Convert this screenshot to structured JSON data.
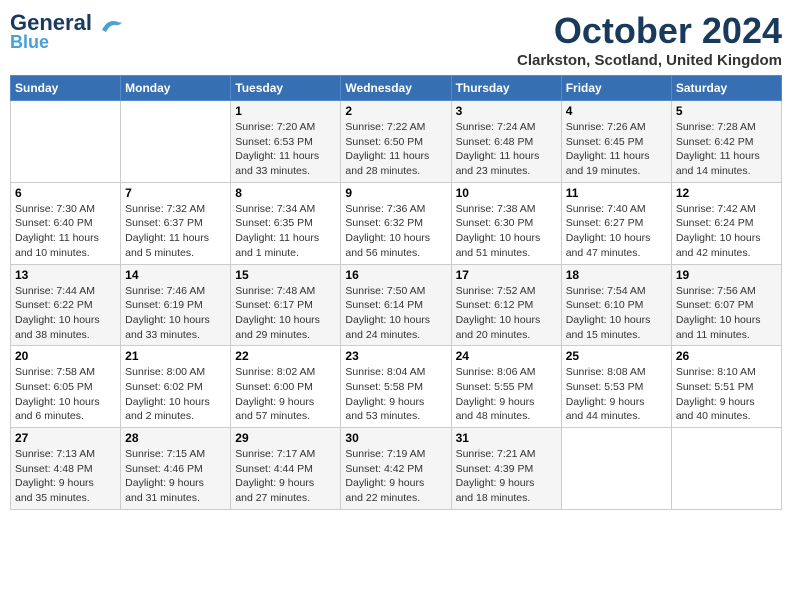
{
  "logo": {
    "line1": "General",
    "line2": "Blue"
  },
  "header": {
    "month": "October 2024",
    "location": "Clarkston, Scotland, United Kingdom"
  },
  "weekdays": [
    "Sunday",
    "Monday",
    "Tuesday",
    "Wednesday",
    "Thursday",
    "Friday",
    "Saturday"
  ],
  "weeks": [
    [
      {
        "day": "",
        "info": ""
      },
      {
        "day": "",
        "info": ""
      },
      {
        "day": "1",
        "info": "Sunrise: 7:20 AM\nSunset: 6:53 PM\nDaylight: 11 hours\nand 33 minutes."
      },
      {
        "day": "2",
        "info": "Sunrise: 7:22 AM\nSunset: 6:50 PM\nDaylight: 11 hours\nand 28 minutes."
      },
      {
        "day": "3",
        "info": "Sunrise: 7:24 AM\nSunset: 6:48 PM\nDaylight: 11 hours\nand 23 minutes."
      },
      {
        "day": "4",
        "info": "Sunrise: 7:26 AM\nSunset: 6:45 PM\nDaylight: 11 hours\nand 19 minutes."
      },
      {
        "day": "5",
        "info": "Sunrise: 7:28 AM\nSunset: 6:42 PM\nDaylight: 11 hours\nand 14 minutes."
      }
    ],
    [
      {
        "day": "6",
        "info": "Sunrise: 7:30 AM\nSunset: 6:40 PM\nDaylight: 11 hours\nand 10 minutes."
      },
      {
        "day": "7",
        "info": "Sunrise: 7:32 AM\nSunset: 6:37 PM\nDaylight: 11 hours\nand 5 minutes."
      },
      {
        "day": "8",
        "info": "Sunrise: 7:34 AM\nSunset: 6:35 PM\nDaylight: 11 hours\nand 1 minute."
      },
      {
        "day": "9",
        "info": "Sunrise: 7:36 AM\nSunset: 6:32 PM\nDaylight: 10 hours\nand 56 minutes."
      },
      {
        "day": "10",
        "info": "Sunrise: 7:38 AM\nSunset: 6:30 PM\nDaylight: 10 hours\nand 51 minutes."
      },
      {
        "day": "11",
        "info": "Sunrise: 7:40 AM\nSunset: 6:27 PM\nDaylight: 10 hours\nand 47 minutes."
      },
      {
        "day": "12",
        "info": "Sunrise: 7:42 AM\nSunset: 6:24 PM\nDaylight: 10 hours\nand 42 minutes."
      }
    ],
    [
      {
        "day": "13",
        "info": "Sunrise: 7:44 AM\nSunset: 6:22 PM\nDaylight: 10 hours\nand 38 minutes."
      },
      {
        "day": "14",
        "info": "Sunrise: 7:46 AM\nSunset: 6:19 PM\nDaylight: 10 hours\nand 33 minutes."
      },
      {
        "day": "15",
        "info": "Sunrise: 7:48 AM\nSunset: 6:17 PM\nDaylight: 10 hours\nand 29 minutes."
      },
      {
        "day": "16",
        "info": "Sunrise: 7:50 AM\nSunset: 6:14 PM\nDaylight: 10 hours\nand 24 minutes."
      },
      {
        "day": "17",
        "info": "Sunrise: 7:52 AM\nSunset: 6:12 PM\nDaylight: 10 hours\nand 20 minutes."
      },
      {
        "day": "18",
        "info": "Sunrise: 7:54 AM\nSunset: 6:10 PM\nDaylight: 10 hours\nand 15 minutes."
      },
      {
        "day": "19",
        "info": "Sunrise: 7:56 AM\nSunset: 6:07 PM\nDaylight: 10 hours\nand 11 minutes."
      }
    ],
    [
      {
        "day": "20",
        "info": "Sunrise: 7:58 AM\nSunset: 6:05 PM\nDaylight: 10 hours\nand 6 minutes."
      },
      {
        "day": "21",
        "info": "Sunrise: 8:00 AM\nSunset: 6:02 PM\nDaylight: 10 hours\nand 2 minutes."
      },
      {
        "day": "22",
        "info": "Sunrise: 8:02 AM\nSunset: 6:00 PM\nDaylight: 9 hours\nand 57 minutes."
      },
      {
        "day": "23",
        "info": "Sunrise: 8:04 AM\nSunset: 5:58 PM\nDaylight: 9 hours\nand 53 minutes."
      },
      {
        "day": "24",
        "info": "Sunrise: 8:06 AM\nSunset: 5:55 PM\nDaylight: 9 hours\nand 48 minutes."
      },
      {
        "day": "25",
        "info": "Sunrise: 8:08 AM\nSunset: 5:53 PM\nDaylight: 9 hours\nand 44 minutes."
      },
      {
        "day": "26",
        "info": "Sunrise: 8:10 AM\nSunset: 5:51 PM\nDaylight: 9 hours\nand 40 minutes."
      }
    ],
    [
      {
        "day": "27",
        "info": "Sunrise: 7:13 AM\nSunset: 4:48 PM\nDaylight: 9 hours\nand 35 minutes."
      },
      {
        "day": "28",
        "info": "Sunrise: 7:15 AM\nSunset: 4:46 PM\nDaylight: 9 hours\nand 31 minutes."
      },
      {
        "day": "29",
        "info": "Sunrise: 7:17 AM\nSunset: 4:44 PM\nDaylight: 9 hours\nand 27 minutes."
      },
      {
        "day": "30",
        "info": "Sunrise: 7:19 AM\nSunset: 4:42 PM\nDaylight: 9 hours\nand 22 minutes."
      },
      {
        "day": "31",
        "info": "Sunrise: 7:21 AM\nSunset: 4:39 PM\nDaylight: 9 hours\nand 18 minutes."
      },
      {
        "day": "",
        "info": ""
      },
      {
        "day": "",
        "info": ""
      }
    ]
  ]
}
